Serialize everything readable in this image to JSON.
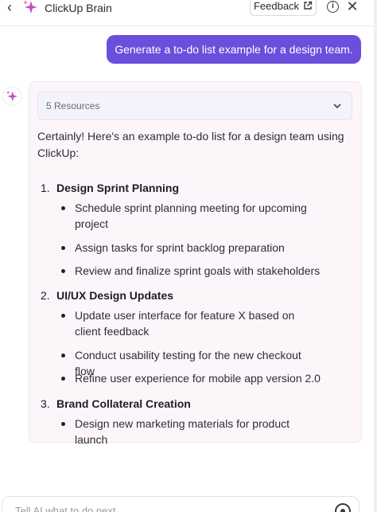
{
  "header": {
    "back_glyph": "‹",
    "title": "ClickUp Brain",
    "feedback_label": "Feedback",
    "info_glyph": "i",
    "close_glyph": "✕"
  },
  "user_message": "Generate a to-do list example for a design team.",
  "ai_message": {
    "resources_label": "5 Resources",
    "intro": "Certainly! Here's an example to-do list for a design team using ClickUp:",
    "sections": [
      {
        "number": "1.",
        "title": "Design Sprint Planning",
        "items": [
          "Schedule sprint planning meeting for upcoming project",
          "Assign tasks for sprint backlog preparation",
          "Review and finalize sprint goals with stakeholders"
        ]
      },
      {
        "number": "2.",
        "title": "UI/UX Design Updates",
        "items": [
          "Update user interface for feature X based on client feedback",
          "Conduct usability testing for the new checkout flow",
          "Refine user experience for mobile app version 2.0"
        ]
      },
      {
        "number": "3.",
        "title": "Brand Collateral Creation",
        "items": [
          "Design new marketing materials for product launch"
        ]
      }
    ]
  },
  "input": {
    "placeholder": "Tell AI what to do next"
  },
  "colors": {
    "accent": "#6b4fdc",
    "card_bg": "#fcf6fb",
    "resources_bg": "#f4f2fb"
  },
  "icons": {
    "brand": "sparkle-icon",
    "feedback": "external-link-icon",
    "resources": "chevron-down-icon",
    "send": "send-icon"
  }
}
